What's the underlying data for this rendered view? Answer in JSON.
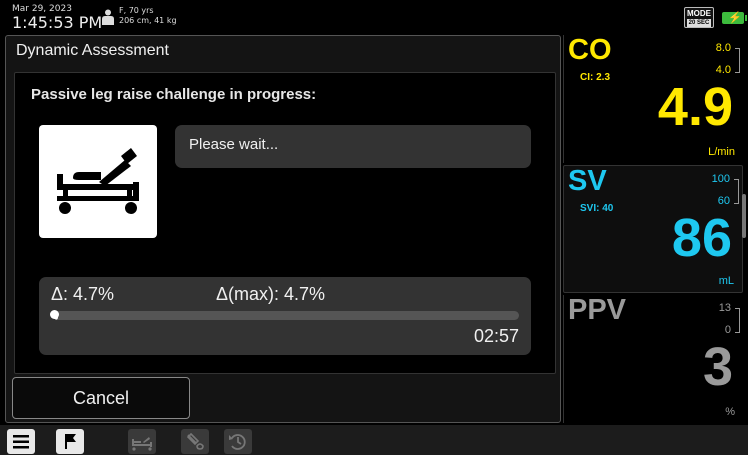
{
  "header": {
    "date": "Mar 29, 2023",
    "time": "1:45:53 PM",
    "patient_line1": "F, 70 yrs",
    "patient_line2": "206 cm, 41 kg",
    "mode_label": "MODE",
    "mode_interval": "20 SEC"
  },
  "dialog": {
    "title": "Dynamic Assessment",
    "instruction": "Passive leg raise challenge in progress:",
    "status": "Please wait...",
    "delta": "Δ: 4.7%",
    "delta_max": "Δ(max): 4.7%",
    "progress_fraction": 0.01,
    "timer": "02:57",
    "cancel_label": "Cancel"
  },
  "params": {
    "co": {
      "name": "CO",
      "sub": "CI: 2.3",
      "hi": "8.0",
      "lo": "4.0",
      "value": "4.9",
      "unit": "L/min",
      "color": "#ffe800"
    },
    "sv": {
      "name": "SV",
      "sub": "SVI: 40",
      "hi": "100",
      "lo": "60",
      "value": "86",
      "unit": "mL",
      "color": "#1ec8f0"
    },
    "ppv": {
      "name": "PPV",
      "hi": "13",
      "lo": "0",
      "value": "3",
      "unit": "%",
      "color": "#9a9a9a"
    }
  },
  "icons": {
    "patient": "person-icon",
    "bed": "leg-raise-bed-icon",
    "battery": "battery-charging-icon",
    "menu": "hamburger-menu-icon",
    "flag": "flag-icon",
    "bed_small": "bed-icon",
    "syringe": "fluid-bolus-icon",
    "history": "history-icon"
  }
}
